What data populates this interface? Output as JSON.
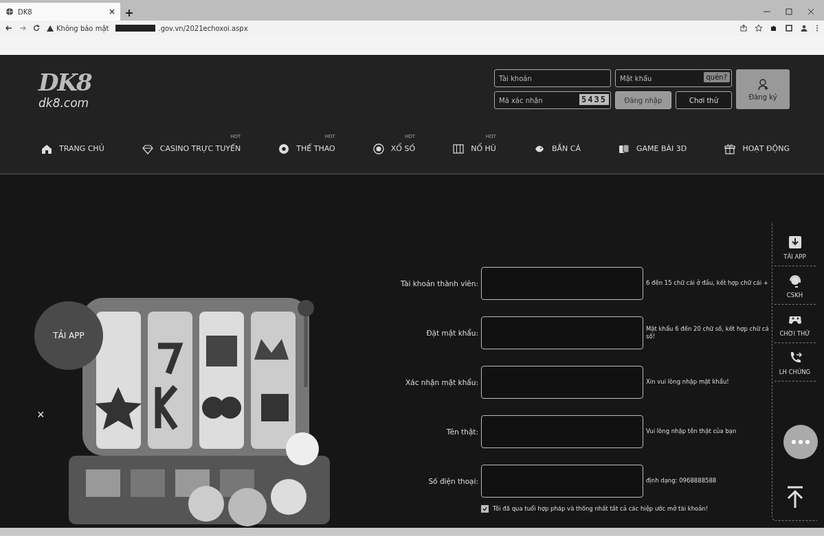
{
  "browser": {
    "tab_title": "DK8",
    "security_label": "Không bảo mật",
    "url": ".gov.vn/2021echoxoi.aspx"
  },
  "header": {
    "logo": "DK8",
    "logo_domain": "dk8.com",
    "username": {
      "placeholder": "Tài khoản"
    },
    "password": {
      "placeholder": "Mật khẩu"
    },
    "forgot_button": "quên?",
    "captcha": {
      "placeholder": "Mã xác nhận"
    },
    "captcha_code": "5435",
    "login_button": "Đăng nhập",
    "trial_button": "Chơi thử",
    "register_button": "Đăng ký"
  },
  "nav": [
    {
      "label": "TRANG CHỦ"
    },
    {
      "label": "CASINO TRỰC TUYẾN",
      "badge": "HOT"
    },
    {
      "label": "THỂ THAO",
      "badge": "HOT"
    },
    {
      "label": "XỔ SỐ",
      "badge": "HOT"
    },
    {
      "label": "NỔ HŨ",
      "badge": "HOT"
    },
    {
      "label": "BẮN CÁ"
    },
    {
      "label": "GAME BÀI 3D"
    },
    {
      "label": "HOẠT ĐỘNG"
    }
  ],
  "promo": {
    "badge": "TẢI APP",
    "close": "×"
  },
  "form": {
    "fields": [
      {
        "label": "Tài khoản thành viên:",
        "hint": "6 đến 15 chữ cái ở đầu, kết hợp chữ cái +"
      },
      {
        "label": "Đặt mật khẩu:",
        "hint": "Mật khẩu 6 đến 20 chữ số, kết hợp chữ cá số!"
      },
      {
        "label": "Xác nhận mật khẩu:",
        "hint": "Xin vui lòng nhập mật khẩu!"
      },
      {
        "label": "Tên thật:",
        "hint": "Vui lòng nhập tên thật của bạn"
      },
      {
        "label": "Số điện thoại:",
        "hint": "định dạng: 0968888588"
      }
    ],
    "agreement": {
      "label": "Tôi đã qua tuổi hợp pháp và thống nhất tất cả các hiệp ước mở tài khoản!",
      "checked": true
    }
  },
  "dock": [
    {
      "label": "TẢI APP"
    },
    {
      "label": "CSKH"
    },
    {
      "label": "CHƠI THỬ"
    },
    {
      "label": "LH CHÚNG"
    }
  ]
}
